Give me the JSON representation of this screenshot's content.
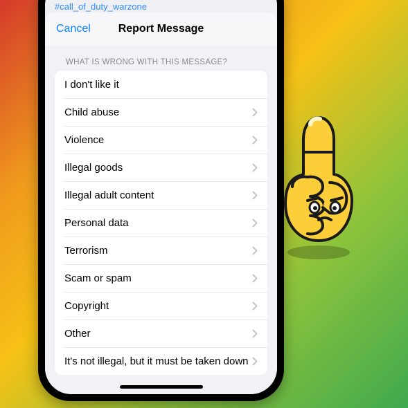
{
  "background_hint": "#call_of_duty_warzone",
  "sheet": {
    "cancel": "Cancel",
    "title": "Report Message",
    "section_header": "WHAT IS WRONG WITH THIS MESSAGE?"
  },
  "options": [
    {
      "label": "I don't like it",
      "disclosure": false
    },
    {
      "label": "Child abuse",
      "disclosure": true
    },
    {
      "label": "Violence",
      "disclosure": true
    },
    {
      "label": "Illegal goods",
      "disclosure": true
    },
    {
      "label": "Illegal adult content",
      "disclosure": true
    },
    {
      "label": "Personal data",
      "disclosure": true
    },
    {
      "label": "Terrorism",
      "disclosure": true
    },
    {
      "label": "Scam or spam",
      "disclosure": true
    },
    {
      "label": "Copyright",
      "disclosure": true
    },
    {
      "label": "Other",
      "disclosure": true
    },
    {
      "label": "It's not illegal, but it must be taken down",
      "disclosure": true
    }
  ]
}
